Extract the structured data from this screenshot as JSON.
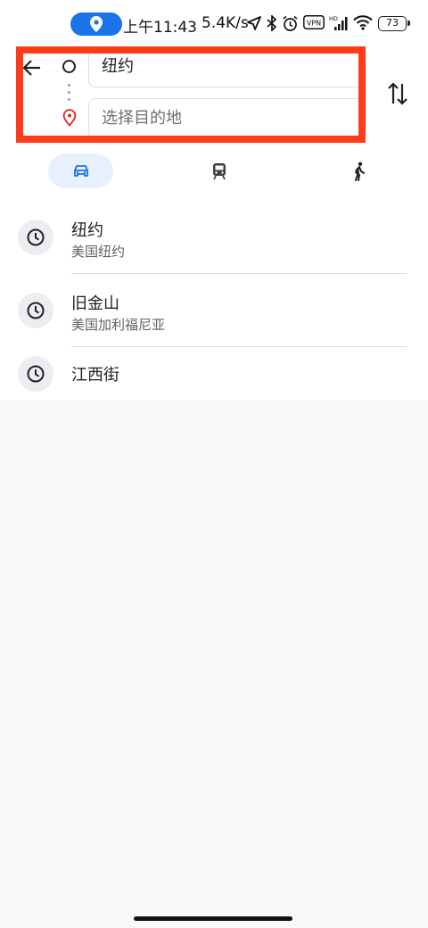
{
  "status_bar": {
    "time": "上午11:43",
    "network_speed": "5.4K/s",
    "vpn_label": "VPN",
    "hd_label": "HD",
    "battery": "73",
    "icons": [
      "location-pill-icon",
      "navigation-arrow-icon",
      "bluetooth-icon",
      "alarm-icon",
      "vpn-icon",
      "signal-icon",
      "wifi-icon",
      "battery-icon"
    ]
  },
  "search": {
    "origin_value": "纽约",
    "destination_placeholder": "选择目的地"
  },
  "modes": {
    "items": [
      "car",
      "transit",
      "walk"
    ],
    "selected": "car"
  },
  "history": [
    {
      "title": "纽约",
      "subtitle": "美国纽约"
    },
    {
      "title": "旧金山",
      "subtitle": "美国加利福尼亚"
    },
    {
      "title": "江西街",
      "subtitle": ""
    }
  ],
  "colors": {
    "accent": "#1a73e8",
    "highlight_border": "#ff3b1a",
    "selected_mode_bg": "#e8f0fe",
    "pin_red": "#d93025"
  }
}
